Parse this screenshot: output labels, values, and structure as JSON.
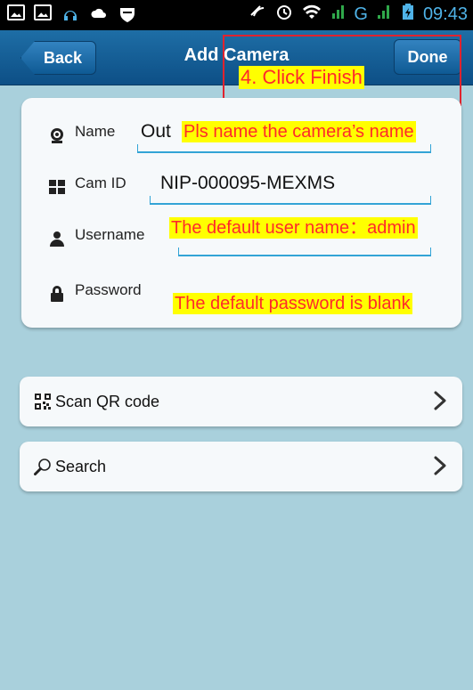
{
  "status_bar": {
    "time": "09:43",
    "network": "G"
  },
  "nav": {
    "back_label": "Back",
    "title": "Add Camera",
    "done_label": "Done"
  },
  "form": {
    "name": {
      "label": "Name",
      "value": "Out"
    },
    "cam_id": {
      "label": "Cam ID",
      "value": "NIP-000095-MEXMS"
    },
    "username": {
      "label": "Username",
      "value": ""
    },
    "password": {
      "label": "Password",
      "value": ""
    }
  },
  "list": {
    "scan_label": "Scan QR code",
    "search_label": "Search"
  },
  "annotations": {
    "finish": "4. Click Finish",
    "name_hint": "Pls name the camera’s name",
    "user_hint": "The default user name：admin",
    "pass_hint": "The default password  is blank"
  },
  "colors": {
    "navbar": "#0d4f86",
    "background": "#a9d0dc",
    "annotation_text": "#ff2a2a",
    "annotation_bg": "#ffff00",
    "accent_underline": "#33a4d6"
  }
}
